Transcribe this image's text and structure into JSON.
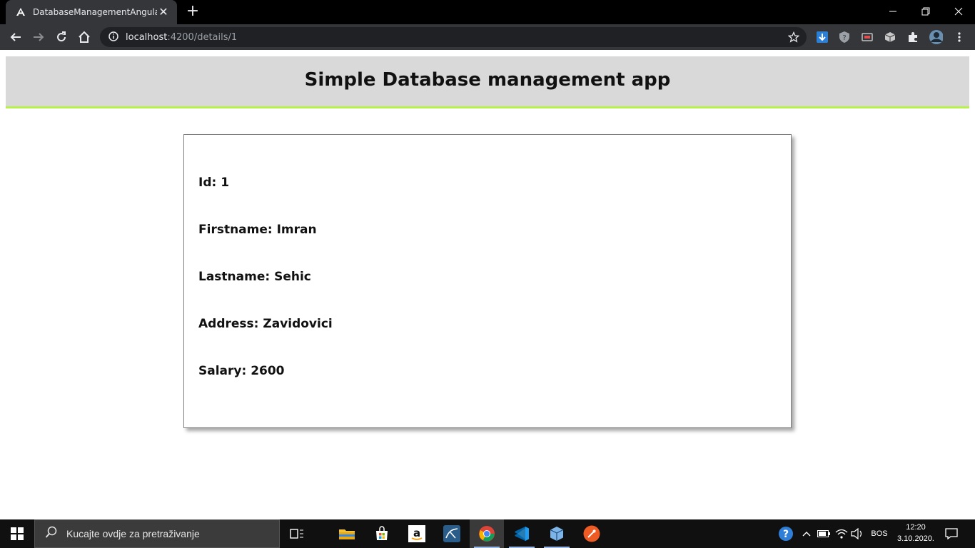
{
  "browser": {
    "tab_title": "DatabaseManagementAngular",
    "url_host": "localhost",
    "url_rest": ":4200/details/1"
  },
  "app": {
    "title": "Simple Database management app"
  },
  "details": {
    "fields": [
      {
        "label": "Id",
        "value": "1",
        "text": "Id: 1"
      },
      {
        "label": "Firstname",
        "value": "Imran",
        "text": "Firstname: Imran"
      },
      {
        "label": "Lastname",
        "value": "Sehic",
        "text": "Lastname: Sehic"
      },
      {
        "label": "Address",
        "value": "Zavidovici",
        "text": "Address: Zavidovici"
      },
      {
        "label": "Salary",
        "value": "2600",
        "text": "Salary: 2600"
      }
    ]
  },
  "taskbar": {
    "search_placeholder": "Kucajte ovdje za pretraživanje",
    "language": "BOS",
    "time": "12:20",
    "date": "3.10.2020."
  },
  "colors": {
    "header_bg": "#d9d9d9",
    "header_accent": "#b6f24a"
  }
}
